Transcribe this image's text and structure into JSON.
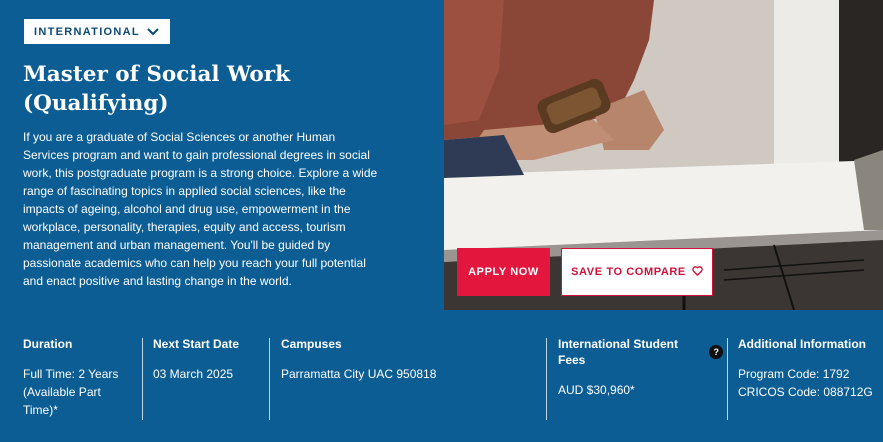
{
  "header": {
    "dropdown_label": "INTERNATIONAL"
  },
  "program": {
    "title_line1": "Master of Social Work",
    "title_line2": "(Qualifying)",
    "description": "If you are a graduate of Social Sciences or another Human Services program and want to gain professional degrees in social work, this postgraduate program is a strong choice. Explore a wide range of fascinating topics in applied social sciences, like the impacts of ageing, alcohol and drug use, empowerment in the workplace, personality, therapies, equity and access, tourism management and urban management. You'll be guided by passionate academics who can help you reach your full potential and enact positive and lasting change in the world."
  },
  "actions": {
    "apply_label": "APPLY NOW",
    "compare_label": "SAVE TO COMPARE"
  },
  "details": {
    "duration": {
      "label": "Duration",
      "value": "Full Time: 2 Years (Available Part Time)*"
    },
    "next_start": {
      "label": "Next Start Date",
      "value": "03 March 2025"
    },
    "campuses": {
      "label": "Campuses",
      "value": "Parramatta City UAC 950818"
    },
    "fees": {
      "label": "International Student Fees",
      "value": "AUD $30,960*",
      "help": "?"
    },
    "additional": {
      "label": "Additional Information",
      "program_code": "Program Code: 1792",
      "cricos_code": "CRICOS Code: 088712G"
    }
  },
  "colors": {
    "brand_blue": "#0b5d94",
    "accent_red": "#e3173e"
  },
  "icons": {
    "dropdown": "chevron-down-icon",
    "compare": "heart-icon",
    "fees_help": "help-icon"
  }
}
